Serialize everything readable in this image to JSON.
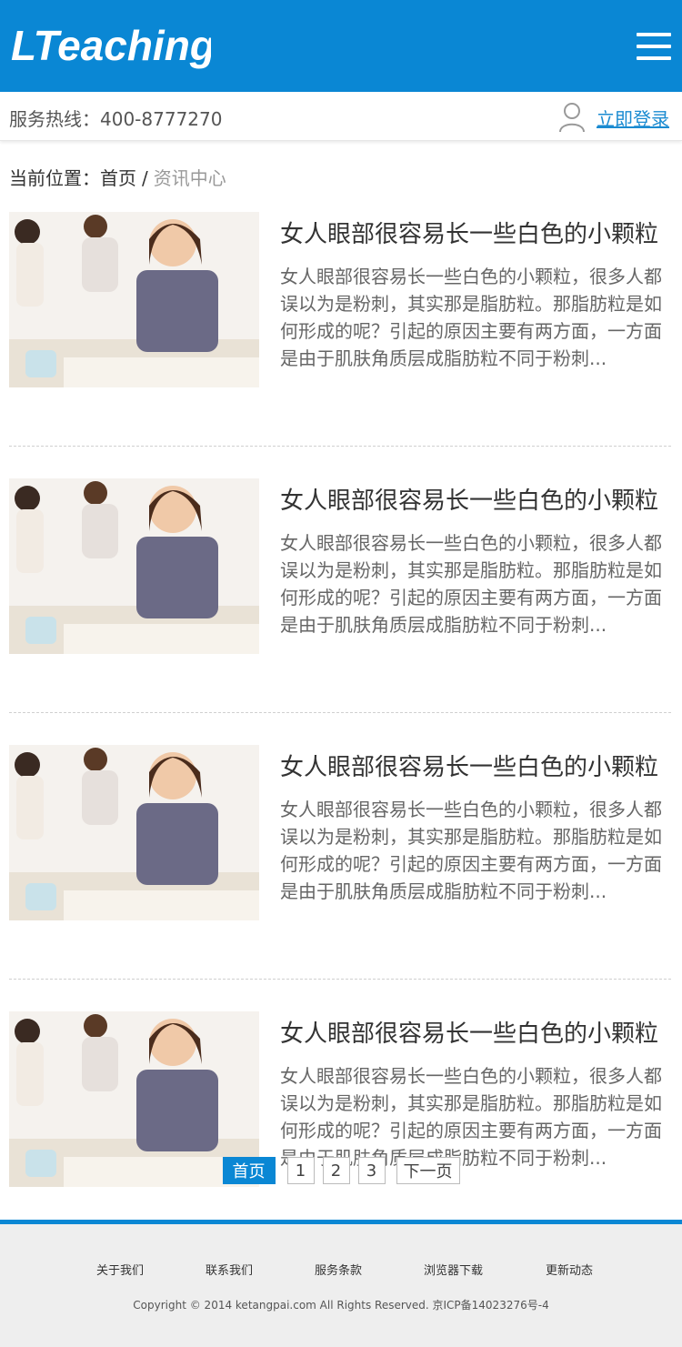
{
  "header": {
    "logo_text": "LTeaching",
    "brand_color": "#0a87d4",
    "menu_icon": "hamburger-menu-icon"
  },
  "subbar": {
    "hotline": "服务热线：400-8777270",
    "login_label": "立即登录",
    "user_icon": "user-icon"
  },
  "breadcrumb": {
    "prefix": "当前位置：",
    "home": "首页",
    "separator": "/",
    "current": "资讯中心"
  },
  "articles": [
    {
      "title": "女人眼部很容易长一些白色的小颗粒",
      "summary": "女人眼部很容易长一些白色的小颗粒，很多人都误以为是粉刺，其实那是脂肪粒。那脂肪粒是如何形成的呢？引起的原因主要有两方面，一方面是由于肌肤角质层成脂肪粒不同于粉刺..."
    },
    {
      "title": "女人眼部很容易长一些白色的小颗粒",
      "summary": "女人眼部很容易长一些白色的小颗粒，很多人都误以为是粉刺，其实那是脂肪粒。那脂肪粒是如何形成的呢？引起的原因主要有两方面，一方面是由于肌肤角质层成脂肪粒不同于粉刺..."
    },
    {
      "title": "女人眼部很容易长一些白色的小颗粒",
      "summary": "女人眼部很容易长一些白色的小颗粒，很多人都误以为是粉刺，其实那是脂肪粒。那脂肪粒是如何形成的呢？引起的原因主要有两方面，一方面是由于肌肤角质层成脂肪粒不同于粉刺..."
    },
    {
      "title": "女人眼部很容易长一些白色的小颗粒",
      "summary": "女人眼部很容易长一些白色的小颗粒，很多人都误以为是粉刺，其实那是脂肪粒。那脂肪粒是如何形成的呢？引起的原因主要有两方面，一方面是由于肌肤角质层成脂肪粒不同于粉刺..."
    }
  ],
  "pagination": {
    "first": "首页",
    "pages": [
      "1",
      "2",
      "3"
    ],
    "next": "下一页"
  },
  "footer": {
    "links": [
      "关于我们",
      "联系我们",
      "服务条款",
      "浏览器下载",
      "更新动态"
    ],
    "copyright": "Copyright © 2014 ketangpai.com All Rights Reserved. 京ICP备14023276号-4"
  }
}
